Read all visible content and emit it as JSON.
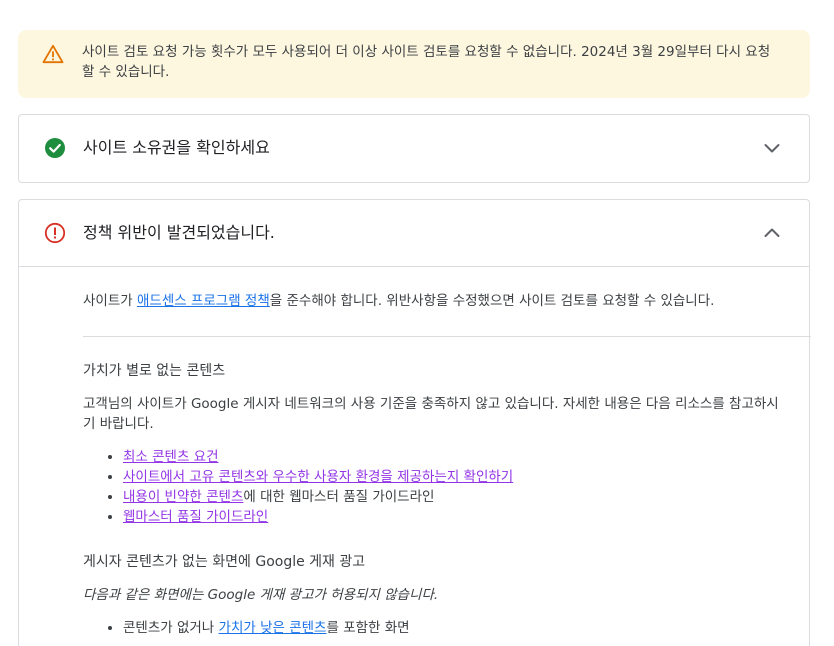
{
  "banner": {
    "icon": "warning-icon",
    "color": "#e37400",
    "background": "#fef7e0",
    "text": "사이트 검토 요청 가능 횟수가 모두 사용되어 더 이상 사이트 검토를 요청할 수 없습니다. 2024년 3월 29일부터 다시 요청할 수 있습니다."
  },
  "ownership": {
    "icon": "check-circle-icon",
    "color": "#1e8e3e",
    "title": "사이트 소유권을 확인하세요",
    "chevron": "chevron-down-icon"
  },
  "policy": {
    "icon": "error-circle-icon",
    "color": "#d93025",
    "title": "정책 위반이 발견되었습니다.",
    "chevron": "chevron-up-icon",
    "intro_before": "사이트가 ",
    "intro_link": "애드센스 프로그램 정책",
    "intro_after": "을 준수해야 합니다. 위반사항을 수정했으면 사이트 검토를 요청할 수 있습니다.",
    "section1_title": "가치가 별로 없는 콘텐츠",
    "section1_desc": "고객님의 사이트가 Google 게시자 네트워크의 사용 기준을 충족하지 않고 있습니다. 자세한 내용은 다음 리소스를 참고하시기 바랍니다.",
    "resources": [
      {
        "link": "최소 콘텐츠 요건",
        "suffix": ""
      },
      {
        "link": "사이트에서 고유 콘텐츠와 우수한 사용자 환경을 제공하는지 확인하기",
        "suffix": ""
      },
      {
        "link": "내용이 빈약한 콘텐츠",
        "suffix": "에 대한 웹마스터 품질 가이드라인"
      },
      {
        "link": "웹마스터 품질 가이드라인",
        "suffix": ""
      }
    ],
    "section2_title": "게시자 콘텐츠가 없는 화면에 Google 게재 광고",
    "section2_italic": "다음과 같은 화면에는 Google 게재 광고가 허용되지 않습니다.",
    "cut_item_before": "콘텐츠가 없거나 ",
    "cut_item_link": "가치가 낮은 콘텐츠",
    "cut_item_after": "를 포함한 화면"
  },
  "colors": {
    "link_blue": "#1a73e8",
    "link_visited": "#9334e6",
    "border": "#dadce0"
  }
}
